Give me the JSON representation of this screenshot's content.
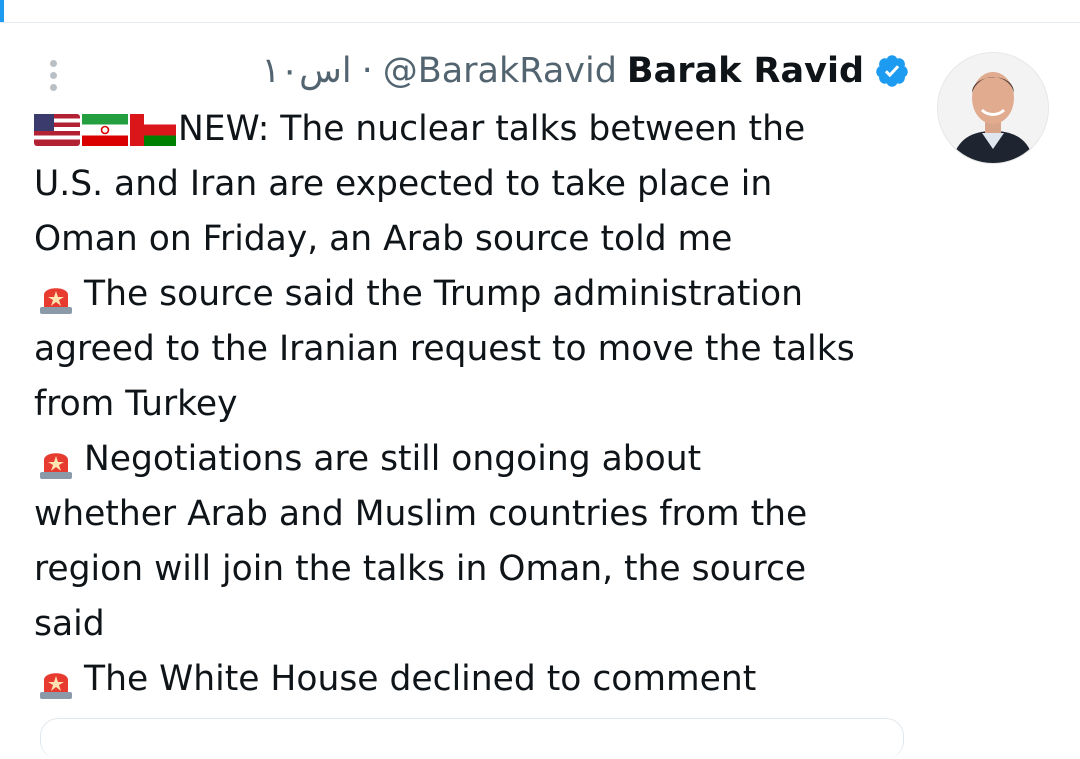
{
  "author": {
    "name": "Barak Ravid",
    "handle": "@BarakRavid",
    "time": "۱۰اس",
    "separator": "·",
    "verified_color": "#1d9bf0"
  },
  "icons": {
    "more": "more-vertical-icon",
    "verified": "verified-badge-icon",
    "siren": "rotating-light-icon",
    "flags": [
      "us-flag-icon",
      "iran-flag-icon",
      "oman-flag-icon"
    ]
  },
  "tweet": {
    "line1": "NEW: The nuclear talks between the",
    "line2": "U.S. and Iran are expected to take place in",
    "line3": "Oman on Friday, an Arab source told me",
    "line4": "The source said the Trump administration",
    "line5": "agreed to the Iranian request to move the talks",
    "line6": "from Turkey",
    "line7": "Negotiations are still ongoing about",
    "line8": "whether Arab and Muslim countries from the",
    "line9": "region will join the talks in Oman, the source",
    "line10": "said",
    "line11": "The White House declined to comment"
  }
}
